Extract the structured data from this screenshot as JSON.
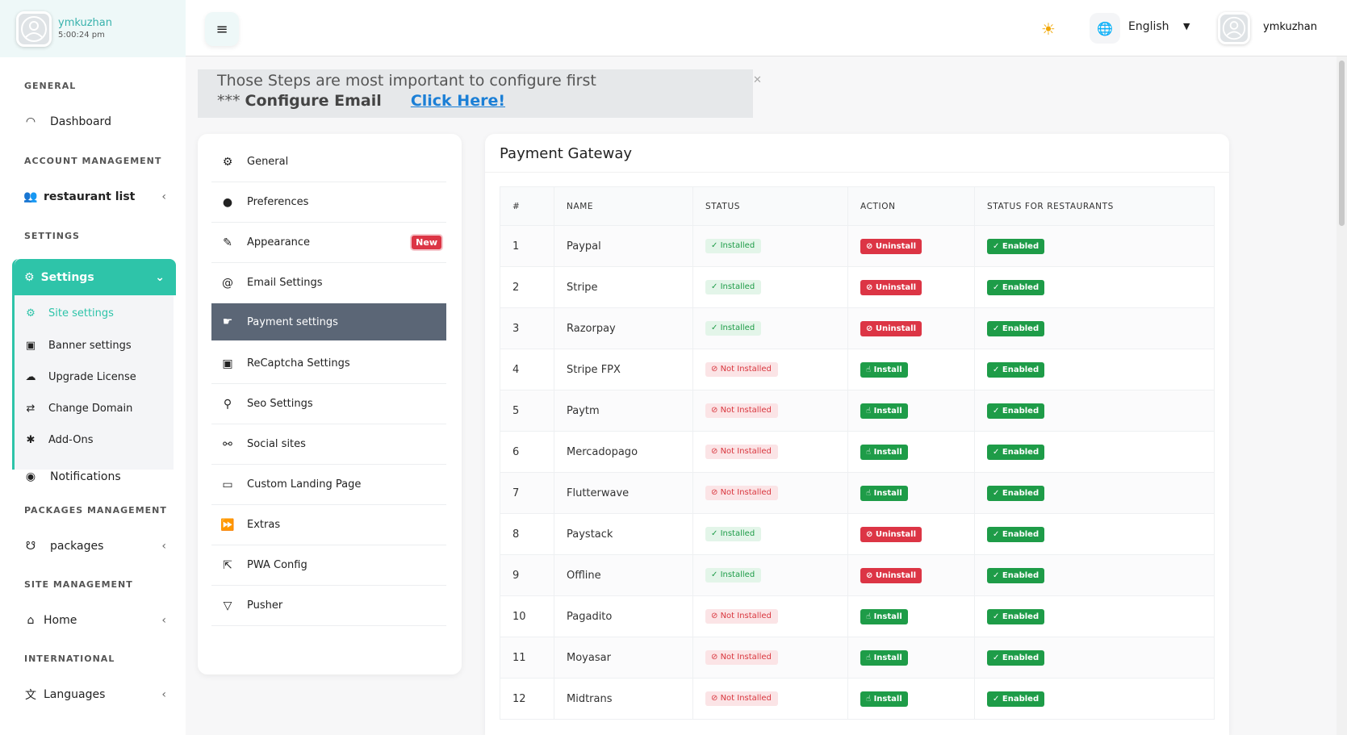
{
  "user": {
    "name": "ymkuzhan",
    "time": "5:00:24 pm"
  },
  "sidebar": {
    "sections": {
      "general": "GENERAL",
      "account": "ACCOUNT MANAGEMENT",
      "settings": "SETTINGS",
      "packages": "PACKAGES MANAGEMENT",
      "site": "SITE MANAGEMENT",
      "international": "INTERNATIONAL"
    },
    "dashboard": "Dashboard",
    "restaurant_list": "restaurant list",
    "settings_label": "Settings",
    "sub_items": [
      "Site settings",
      "Banner settings",
      "Upgrade License",
      "Change Domain",
      "Add-Ons"
    ],
    "notifications": "Notifications",
    "packages": "packages",
    "home": "Home",
    "languages": "Languages"
  },
  "topbar": {
    "language": "English",
    "username": "ymkuzhan"
  },
  "notice": {
    "line1": "Those Steps are most important to configure first",
    "prefix": "***",
    "configure": "Configure Email",
    "link": "Click Here!"
  },
  "settings_menu": {
    "items": [
      "General",
      "Preferences",
      "Appearance",
      "Email Settings",
      "Payment settings",
      "ReCaptcha Settings",
      "Seo Settings",
      "Social sites",
      "Custom Landing Page",
      "Extras",
      "PWA Config",
      "Pusher"
    ],
    "new_badge": "New"
  },
  "payment_gateway": {
    "title": "Payment Gateway",
    "columns": [
      "#",
      "NAME",
      "STATUS",
      "ACTION",
      "STATUS FOR RESTAURANTS"
    ],
    "rows": [
      {
        "num": "1",
        "name": "Paypal",
        "status": "Installed",
        "action": "Uninstall",
        "restaurant_status": "Enabled"
      },
      {
        "num": "2",
        "name": "Stripe",
        "status": "Installed",
        "action": "Uninstall",
        "restaurant_status": "Enabled"
      },
      {
        "num": "3",
        "name": "Razorpay",
        "status": "Installed",
        "action": "Uninstall",
        "restaurant_status": "Enabled"
      },
      {
        "num": "4",
        "name": "Stripe FPX",
        "status": "Not Installed",
        "action": "Install",
        "restaurant_status": "Enabled"
      },
      {
        "num": "5",
        "name": "Paytm",
        "status": "Not Installed",
        "action": "Install",
        "restaurant_status": "Enabled"
      },
      {
        "num": "6",
        "name": "Mercadopago",
        "status": "Not Installed",
        "action": "Install",
        "restaurant_status": "Enabled"
      },
      {
        "num": "7",
        "name": "Flutterwave",
        "status": "Not Installed",
        "action": "Install",
        "restaurant_status": "Enabled"
      },
      {
        "num": "8",
        "name": "Paystack",
        "status": "Installed",
        "action": "Uninstall",
        "restaurant_status": "Enabled"
      },
      {
        "num": "9",
        "name": "Offline",
        "status": "Installed",
        "action": "Uninstall",
        "restaurant_status": "Enabled"
      },
      {
        "num": "10",
        "name": "Pagadito",
        "status": "Not Installed",
        "action": "Install",
        "restaurant_status": "Enabled"
      },
      {
        "num": "11",
        "name": "Moyasar",
        "status": "Not Installed",
        "action": "Install",
        "restaurant_status": "Enabled"
      },
      {
        "num": "12",
        "name": "Midtrans",
        "status": "Not Installed",
        "action": "Install",
        "restaurant_status": "Enabled"
      }
    ]
  },
  "colors": {
    "accent": "#2ec4a9",
    "success": "#1e9c48",
    "danger": "#dc3545",
    "active_menu": "#5b6676",
    "link": "#1b7fd6"
  }
}
